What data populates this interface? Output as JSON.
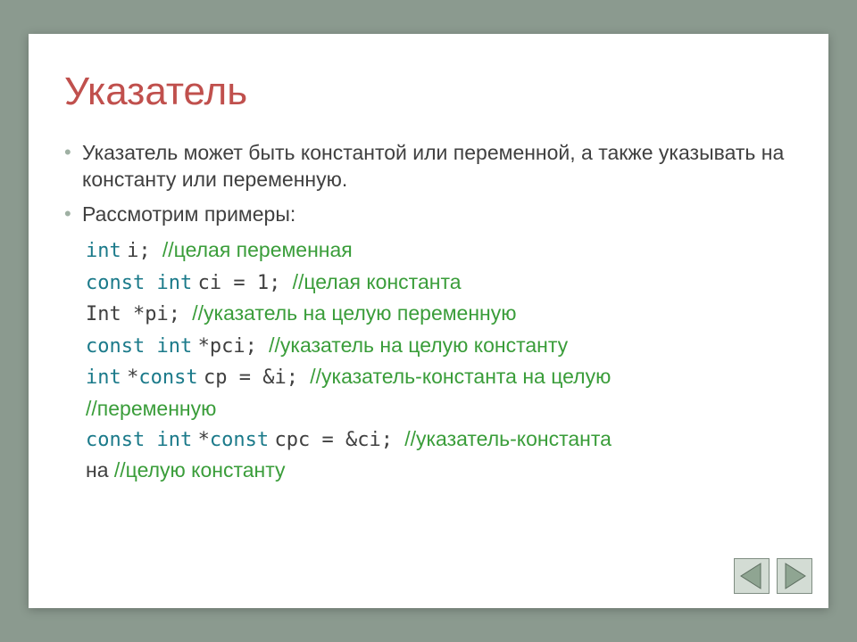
{
  "title": "Указатель",
  "bullets": [
    "Указатель может быть константой или переменной, а также указывать на константу или переменную.",
    "Рассмотрим примеры:"
  ],
  "code": [
    {
      "kw1": "int",
      "t1": " i; ",
      "cm": "//целая переменная"
    },
    {
      "kw1": "const int",
      "t1": " ci = 1; ",
      "cm": "//целая константа"
    },
    {
      "t1": "Int *pi; ",
      "cm": "//указатель на целую переменную"
    },
    {
      "kw1": "const int",
      "t1": " *pci; ",
      "cm": "//указатель на целую константу"
    },
    {
      "kw1": "int",
      "t1": " *",
      "kw2": "const",
      "t2": " cp = &i; ",
      "cm": "//указатель-константа на целую",
      "cm2": "//переменную"
    },
    {
      "kw1": "const int",
      "t1": " *",
      "kw2": "const",
      "t2": " cpc = &ci; ",
      "cm": "//указатель-константа",
      "cm2a": "на ",
      "cm2b": "//целую константу"
    }
  ],
  "colors": {
    "background": "#8b9a8f",
    "title": "#c0504d",
    "keyword": "#1b7a8a",
    "comment": "#3a9d3a",
    "text": "#404040"
  }
}
